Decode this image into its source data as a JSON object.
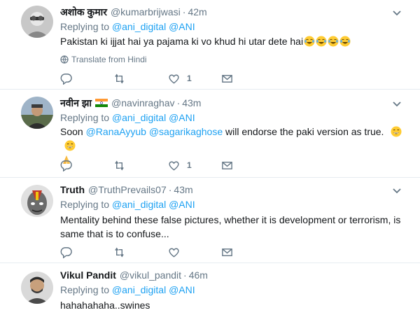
{
  "tweets": [
    {
      "name": "अशोक कुमार",
      "handle": "@kumarbrijwasi",
      "time": "42m",
      "replying_prefix": "Replying to",
      "mentions": [
        "@ani_digital",
        "@ANI"
      ],
      "text": "Pakistan ki ijjat hai ya pajama ki vo khud hi utar dete hai",
      "emoji": [
        "joy-emoji",
        "joy-emoji",
        "joy-emoji",
        "joy-emoji"
      ],
      "translate_label": "Translate from Hindi",
      "like_count": "1"
    },
    {
      "name": "नवीन झा",
      "handle": "@navinraghav",
      "time": "43m",
      "replying_prefix": "Replying to",
      "mentions": [
        "@ani_digital",
        "@ANI"
      ],
      "text_pre": "Soon",
      "text_mentions": [
        "@RanaAyyub",
        "@sagarikaghose"
      ],
      "text_post": "will endorse the paki version as true.",
      "emoji": [
        "grin-emoji",
        "grin-emoji",
        "pray-emoji"
      ],
      "like_count": "1"
    },
    {
      "name": "Truth",
      "handle": "@TruthPrevails07",
      "time": "43m",
      "replying_prefix": "Replying to",
      "mentions": [
        "@ani_digital",
        "@ANI"
      ],
      "text_line1": "Mentality behind these false pictures, whether it is development or terrorism, is",
      "text_line2": "same that is to confuse...",
      "like_count": ""
    },
    {
      "name": "Vikul Pandit",
      "handle": "@vikul_pandit",
      "time": "46m",
      "replying_prefix": "Replying to",
      "mentions": [
        "@ani_digital",
        "@ANI"
      ],
      "text": "hahahahaha..swines"
    }
  ],
  "separator": "·",
  "colors": {
    "link": "#1da1f2",
    "secondary": "#657786",
    "text": "#14171a",
    "divider": "#e6ecf0"
  }
}
